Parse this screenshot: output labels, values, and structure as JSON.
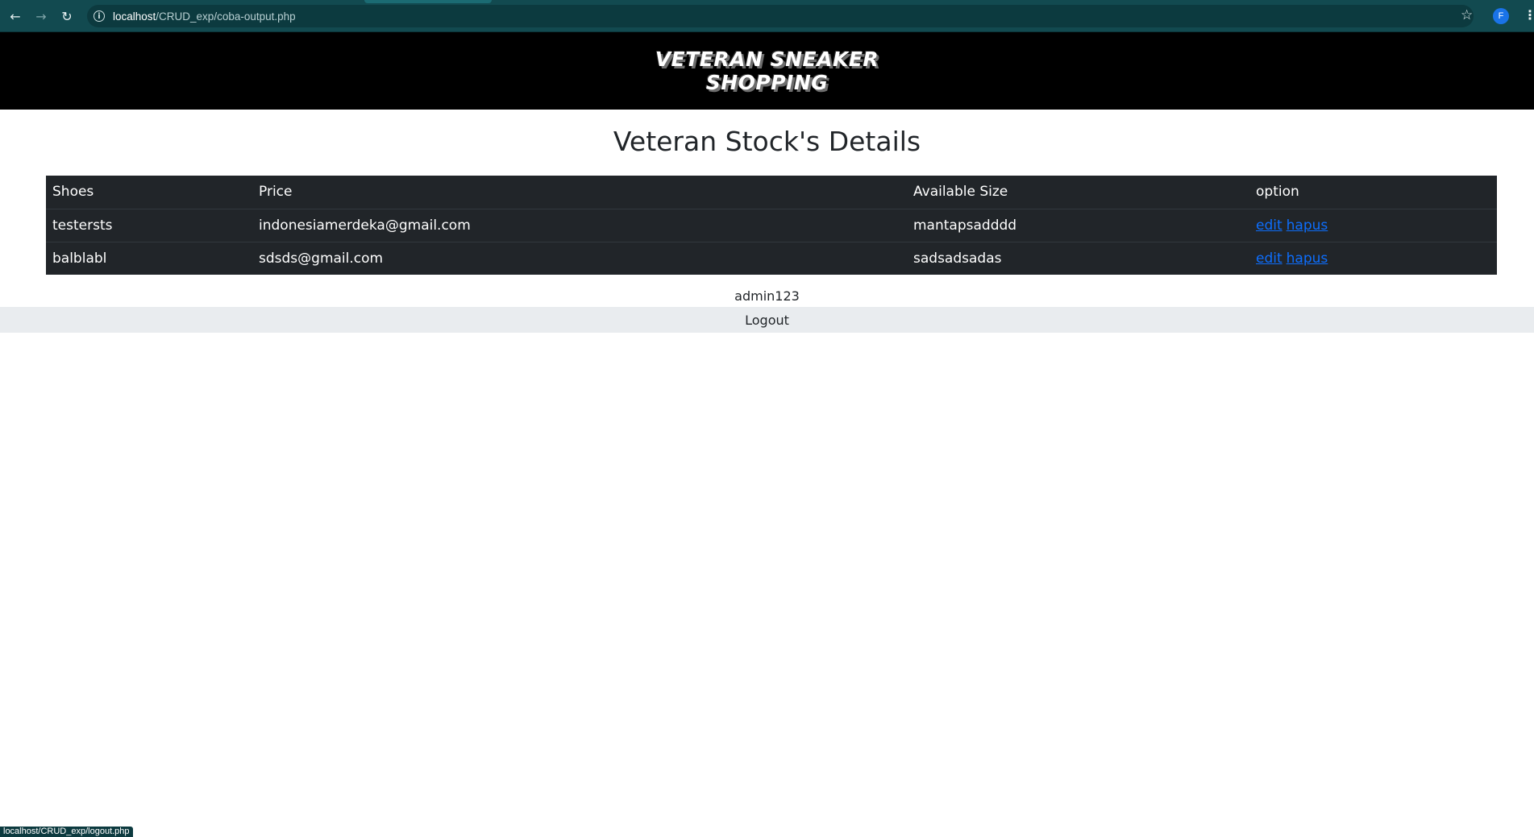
{
  "browser": {
    "url_host": "localhost",
    "url_path": "/CRUD_exp/coba-output.php",
    "profile_initial": "F",
    "icons": {
      "back": "arrow-left-icon",
      "forward": "arrow-right-icon",
      "reload": "reload-icon",
      "info": "info-icon",
      "bookmark": "star-icon",
      "menu": "kebab-menu-icon"
    },
    "status_text": "localhost/CRUD_exp/logout.php"
  },
  "header": {
    "logo_line1": "VETERAN SNEAKER",
    "logo_line2": "SHOPPING"
  },
  "main": {
    "title": "Veteran Stock's Details",
    "table": {
      "columns": [
        "Shoes",
        "Price",
        "Available Size",
        "option"
      ],
      "rows": [
        {
          "shoes": "testersts",
          "price": "indonesiamerdeka@gmail.com",
          "size": "mantapsadddd",
          "edit": "edit",
          "delete": "hapus"
        },
        {
          "shoes": "balblabl",
          "price": "sdsds@gmail.com",
          "size": "sadsadsadas",
          "edit": "edit",
          "delete": "hapus"
        }
      ]
    },
    "username": "admin123",
    "logout_label": "Logout"
  },
  "colors": {
    "browser_chrome": "#124a50",
    "header_bg": "#000000",
    "table_bg": "#212529",
    "link": "#0d6efd",
    "logout_bg": "#e9ecef"
  }
}
